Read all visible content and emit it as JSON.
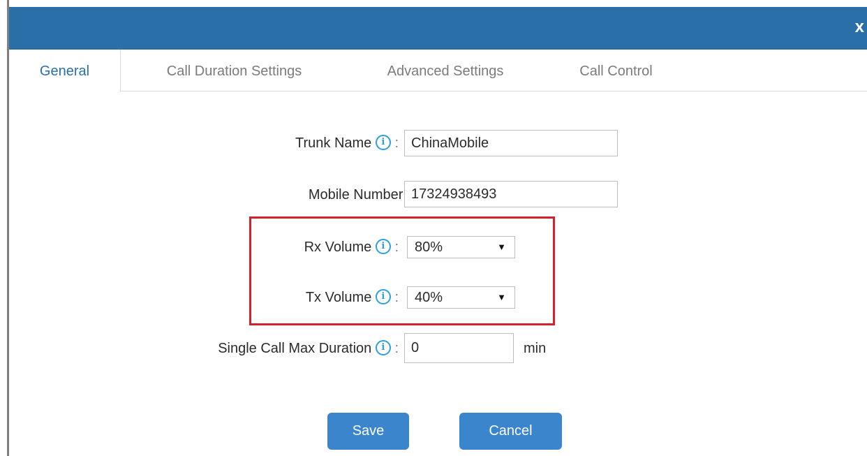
{
  "dialog": {
    "close_label": "x"
  },
  "tabs": [
    {
      "label": "General",
      "active": true
    },
    {
      "label": "Call Duration Settings",
      "active": false
    },
    {
      "label": "Advanced Settings",
      "active": false
    },
    {
      "label": "Call Control",
      "active": false
    }
  ],
  "form": {
    "trunk_name": {
      "label": "Trunk Name",
      "info_icon": "i",
      "colon": ":",
      "value": "ChinaMobile"
    },
    "mobile_number": {
      "label": "Mobile Number:",
      "value": "17324938493"
    },
    "rx_volume": {
      "label": "Rx Volume",
      "info_icon": "i",
      "colon": ":",
      "selected": "80%"
    },
    "tx_volume": {
      "label": "Tx Volume",
      "info_icon": "i",
      "colon": ":",
      "selected": "40%"
    },
    "single_call_max_duration": {
      "label": "Single Call Max Duration",
      "info_icon": "i",
      "colon": ":",
      "value": "0",
      "unit": "min"
    }
  },
  "buttons": {
    "save_label": "Save",
    "cancel_label": "Cancel"
  },
  "colors": {
    "title_bar": "#2b6fa9",
    "active_tab_text": "#2b6fa9",
    "info_icon": "#2ba0e0",
    "button_bg": "#3b85cd",
    "highlight_border": "#d0222a"
  },
  "icons": {
    "info": "info-circle-icon",
    "dropdown": "chevron-down-icon",
    "close": "close-icon"
  }
}
